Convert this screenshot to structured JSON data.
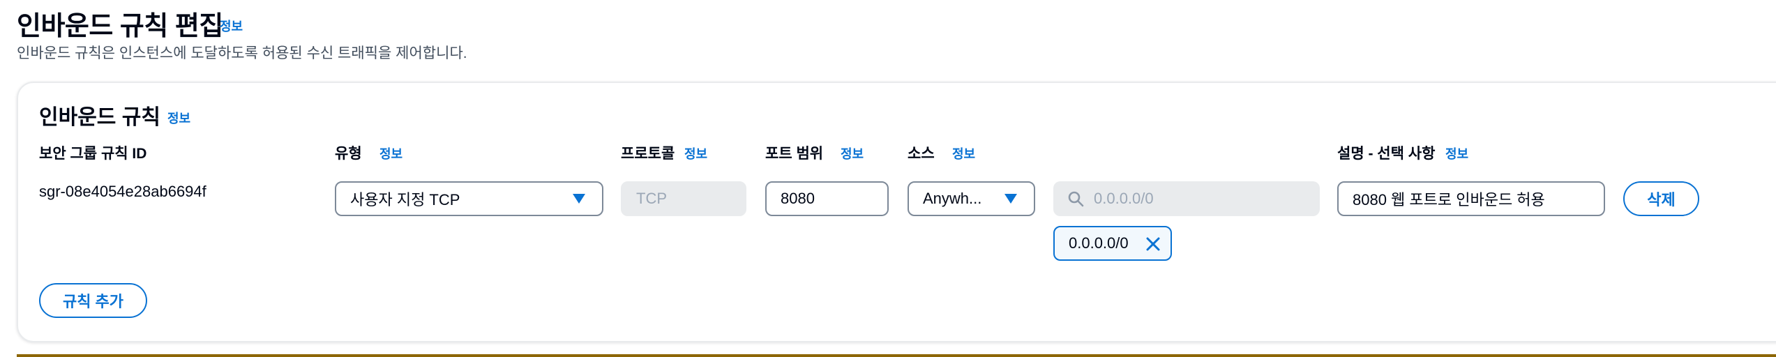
{
  "page": {
    "title": "인바운드 규칙 편집",
    "title_info": "정보",
    "description": "인바운드 규칙은 인스턴스에 도달하도록 허용된 수신 트래픽을 제어합니다."
  },
  "panel": {
    "title": "인바운드 규칙",
    "title_info": "정보"
  },
  "columns": {
    "rule_id": "보안 그룹 규칙 ID",
    "type": "유형",
    "type_info": "정보",
    "protocol": "프로토콜",
    "protocol_info": "정보",
    "port_range": "포트 범위",
    "port_range_info": "정보",
    "source": "소스",
    "source_info": "정보",
    "description": "설명 - 선택 사항",
    "description_info": "정보"
  },
  "rule": {
    "id": "sgr-08e4054e28ab6694f",
    "type_value": "사용자 지정 TCP",
    "protocol_value": "TCP",
    "port_value": "8080",
    "source_value": "Anywh...",
    "cidr_placeholder": "0.0.0.0/0",
    "cidr_token": "0.0.0.0/0",
    "description_value": "8080 웹 포트로 인바운드 허용",
    "delete_label": "삭제"
  },
  "actions": {
    "add_rule_label": "규칙 추가"
  },
  "colors": {
    "link": "#0972d3",
    "text": "#000716",
    "disabled_bg": "#e9ebed",
    "footer_accent": "#8d6605"
  }
}
